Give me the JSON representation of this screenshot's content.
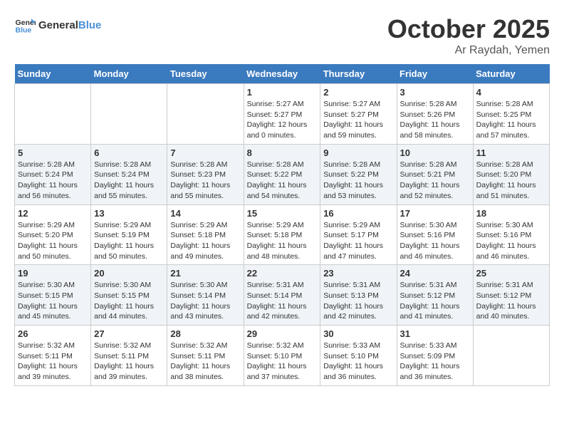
{
  "header": {
    "logo_general": "General",
    "logo_blue": "Blue",
    "month": "October 2025",
    "location": "Ar Raydah, Yemen"
  },
  "days_of_week": [
    "Sunday",
    "Monday",
    "Tuesday",
    "Wednesday",
    "Thursday",
    "Friday",
    "Saturday"
  ],
  "weeks": [
    [
      {
        "day": "",
        "sunrise": "",
        "sunset": "",
        "daylight": ""
      },
      {
        "day": "",
        "sunrise": "",
        "sunset": "",
        "daylight": ""
      },
      {
        "day": "",
        "sunrise": "",
        "sunset": "",
        "daylight": ""
      },
      {
        "day": "1",
        "sunrise": "5:27 AM",
        "sunset": "5:27 PM",
        "daylight": "12 hours and 0 minutes."
      },
      {
        "day": "2",
        "sunrise": "5:27 AM",
        "sunset": "5:27 PM",
        "daylight": "11 hours and 59 minutes."
      },
      {
        "day": "3",
        "sunrise": "5:28 AM",
        "sunset": "5:26 PM",
        "daylight": "11 hours and 58 minutes."
      },
      {
        "day": "4",
        "sunrise": "5:28 AM",
        "sunset": "5:25 PM",
        "daylight": "11 hours and 57 minutes."
      }
    ],
    [
      {
        "day": "5",
        "sunrise": "5:28 AM",
        "sunset": "5:24 PM",
        "daylight": "11 hours and 56 minutes."
      },
      {
        "day": "6",
        "sunrise": "5:28 AM",
        "sunset": "5:24 PM",
        "daylight": "11 hours and 55 minutes."
      },
      {
        "day": "7",
        "sunrise": "5:28 AM",
        "sunset": "5:23 PM",
        "daylight": "11 hours and 55 minutes."
      },
      {
        "day": "8",
        "sunrise": "5:28 AM",
        "sunset": "5:22 PM",
        "daylight": "11 hours and 54 minutes."
      },
      {
        "day": "9",
        "sunrise": "5:28 AM",
        "sunset": "5:22 PM",
        "daylight": "11 hours and 53 minutes."
      },
      {
        "day": "10",
        "sunrise": "5:28 AM",
        "sunset": "5:21 PM",
        "daylight": "11 hours and 52 minutes."
      },
      {
        "day": "11",
        "sunrise": "5:28 AM",
        "sunset": "5:20 PM",
        "daylight": "11 hours and 51 minutes."
      }
    ],
    [
      {
        "day": "12",
        "sunrise": "5:29 AM",
        "sunset": "5:20 PM",
        "daylight": "11 hours and 50 minutes."
      },
      {
        "day": "13",
        "sunrise": "5:29 AM",
        "sunset": "5:19 PM",
        "daylight": "11 hours and 50 minutes."
      },
      {
        "day": "14",
        "sunrise": "5:29 AM",
        "sunset": "5:18 PM",
        "daylight": "11 hours and 49 minutes."
      },
      {
        "day": "15",
        "sunrise": "5:29 AM",
        "sunset": "5:18 PM",
        "daylight": "11 hours and 48 minutes."
      },
      {
        "day": "16",
        "sunrise": "5:29 AM",
        "sunset": "5:17 PM",
        "daylight": "11 hours and 47 minutes."
      },
      {
        "day": "17",
        "sunrise": "5:30 AM",
        "sunset": "5:16 PM",
        "daylight": "11 hours and 46 minutes."
      },
      {
        "day": "18",
        "sunrise": "5:30 AM",
        "sunset": "5:16 PM",
        "daylight": "11 hours and 46 minutes."
      }
    ],
    [
      {
        "day": "19",
        "sunrise": "5:30 AM",
        "sunset": "5:15 PM",
        "daylight": "11 hours and 45 minutes."
      },
      {
        "day": "20",
        "sunrise": "5:30 AM",
        "sunset": "5:15 PM",
        "daylight": "11 hours and 44 minutes."
      },
      {
        "day": "21",
        "sunrise": "5:30 AM",
        "sunset": "5:14 PM",
        "daylight": "11 hours and 43 minutes."
      },
      {
        "day": "22",
        "sunrise": "5:31 AM",
        "sunset": "5:14 PM",
        "daylight": "11 hours and 42 minutes."
      },
      {
        "day": "23",
        "sunrise": "5:31 AM",
        "sunset": "5:13 PM",
        "daylight": "11 hours and 42 minutes."
      },
      {
        "day": "24",
        "sunrise": "5:31 AM",
        "sunset": "5:12 PM",
        "daylight": "11 hours and 41 minutes."
      },
      {
        "day": "25",
        "sunrise": "5:31 AM",
        "sunset": "5:12 PM",
        "daylight": "11 hours and 40 minutes."
      }
    ],
    [
      {
        "day": "26",
        "sunrise": "5:32 AM",
        "sunset": "5:11 PM",
        "daylight": "11 hours and 39 minutes."
      },
      {
        "day": "27",
        "sunrise": "5:32 AM",
        "sunset": "5:11 PM",
        "daylight": "11 hours and 39 minutes."
      },
      {
        "day": "28",
        "sunrise": "5:32 AM",
        "sunset": "5:11 PM",
        "daylight": "11 hours and 38 minutes."
      },
      {
        "day": "29",
        "sunrise": "5:32 AM",
        "sunset": "5:10 PM",
        "daylight": "11 hours and 37 minutes."
      },
      {
        "day": "30",
        "sunrise": "5:33 AM",
        "sunset": "5:10 PM",
        "daylight": "11 hours and 36 minutes."
      },
      {
        "day": "31",
        "sunrise": "5:33 AM",
        "sunset": "5:09 PM",
        "daylight": "11 hours and 36 minutes."
      },
      {
        "day": "",
        "sunrise": "",
        "sunset": "",
        "daylight": ""
      }
    ]
  ]
}
